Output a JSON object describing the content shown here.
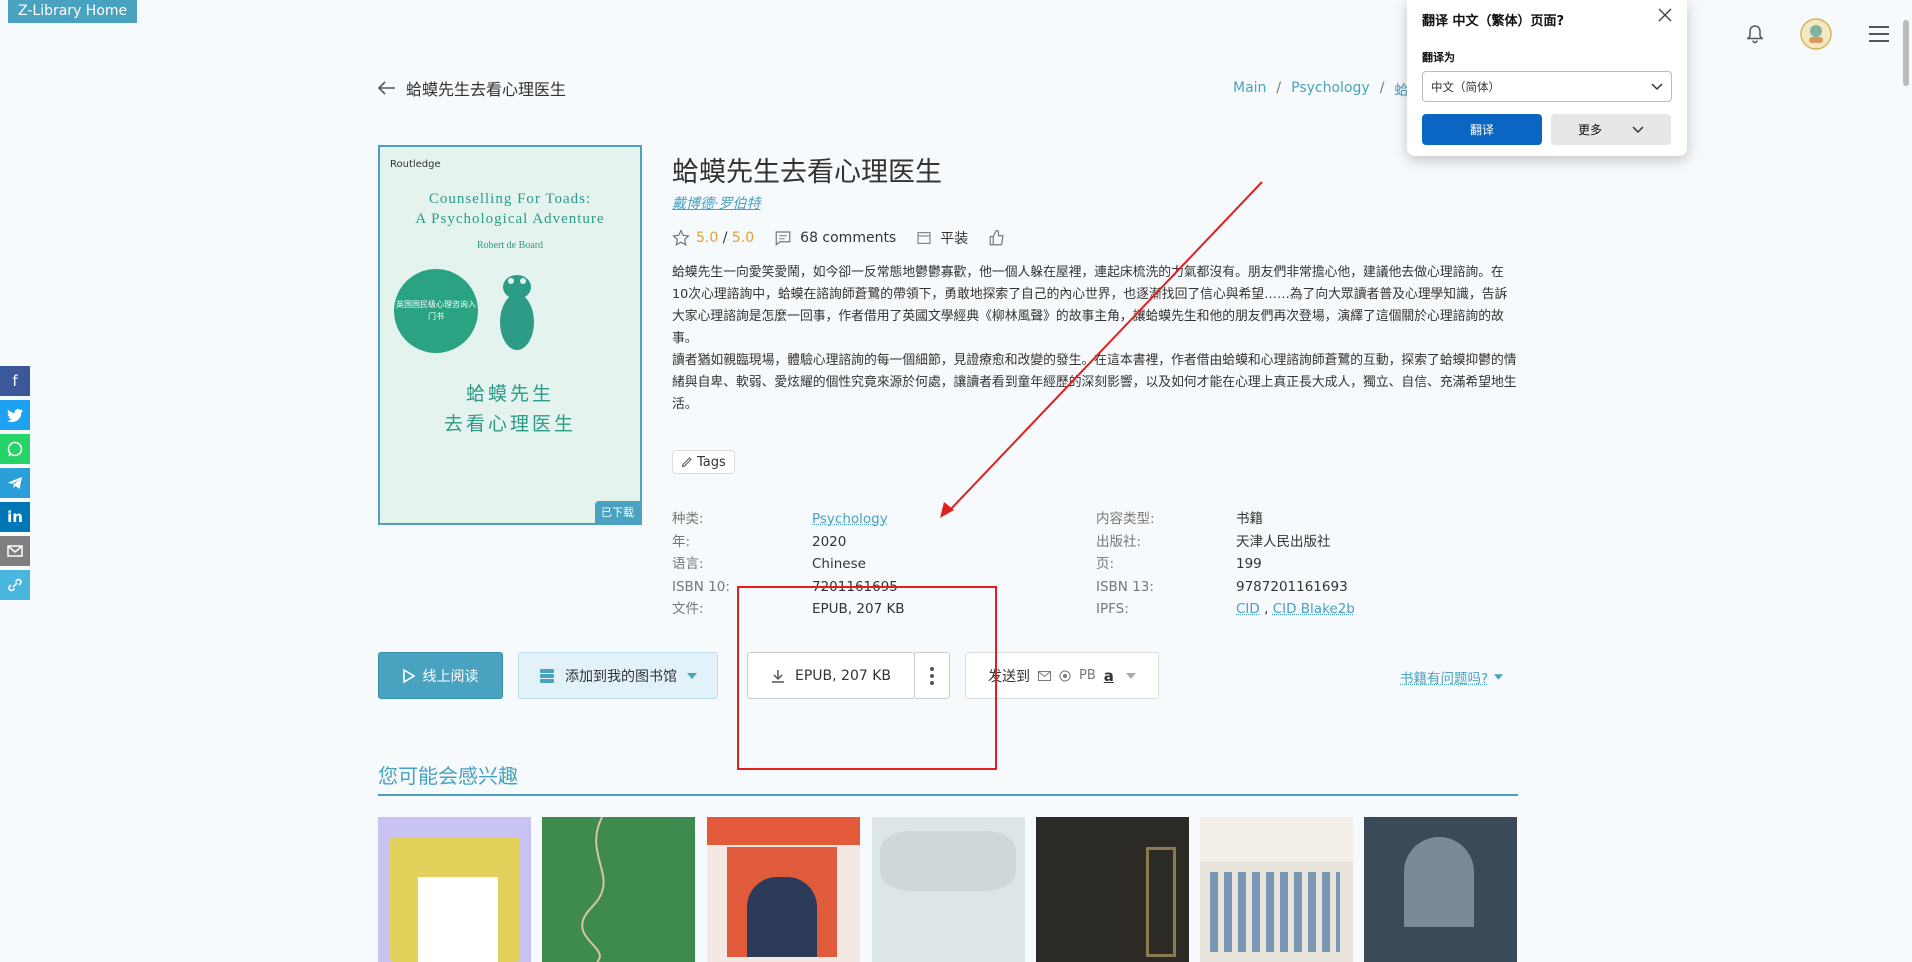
{
  "nav": {
    "home_label": "Z-Library Home"
  },
  "header": {
    "back_title": "蛤蟆先生去看心理医生"
  },
  "breadcrumb": {
    "main": "Main",
    "sep": "/",
    "category": "Psychology",
    "current": "蛤"
  },
  "cover": {
    "publisher_name": "Routledge",
    "english_title_1": "Counselling For Toads:",
    "english_title_2": "A Psychological Adventure",
    "author_en": "Robert de Board",
    "circle_text": "英国国民级心理咨询入门书",
    "chinese_title_1": "蛤蟆先生",
    "chinese_title_2": "去看心理医生",
    "downloaded_badge": "已下载"
  },
  "book": {
    "title": "蛤蟆先生去看心理医生",
    "author": "戴博德·罗伯特",
    "rating": "5.0",
    "rating_sep": " / ",
    "rating_max": "5.0",
    "comments": "68 comments",
    "format_tag": "平装",
    "description": [
      "蛤蟆先生一向愛笑愛鬧，如今卻一反常態地鬱鬱寡歡，他一個人躲在屋裡，連起床梳洗的力氣都沒有。朋友們非常擔心他，建議他去做心理諮詢。在10次心理諮詢中，蛤蟆在諮詢師蒼鷺的帶領下，勇敢地探索了自己的內心世界，也逐漸找回了信心與希望……為了向大眾讀者普及心理學知識，告訴大家心理諮詢是怎麼一回事，作者借用了英國文學經典《柳林風聲》的故事主角，讓蛤蟆先生和他的朋友們再次登場，演繹了這個關於心理諮詢的故事。",
      "讀者猶如親臨現場，體驗心理諮詢的每一個細節，見證療愈和改變的發生。在這本書裡，作者借由蛤蟆和心理諮詢師蒼鷺的互動，探索了蛤蟆抑鬱的情緒與自卑、軟弱、愛炫耀的個性究竟來源於何處，讓讀者看到童年經歷的深刻影響，以及如何才能在心理上真正長大成人，獨立、自信、充滿希望地生活。"
    ],
    "tags_label": "Tags"
  },
  "props_left": [
    {
      "k": "种类:",
      "v": "Psychology"
    },
    {
      "k": "年:",
      "v": "2020"
    },
    {
      "k": "语言:",
      "v": "Chinese"
    },
    {
      "k": "ISBN 10:",
      "v": "7201161695"
    },
    {
      "k": "文件:",
      "v": "EPUB, 207 KB"
    }
  ],
  "props_right": [
    {
      "k": "内容类型:",
      "v": "书籍"
    },
    {
      "k": "出版社:",
      "v": "天津人民出版社"
    },
    {
      "k": "页:",
      "v": "199"
    },
    {
      "k": "ISBN 13:",
      "v": "9787201161693"
    },
    {
      "k": "IPFS:",
      "v1": "CID",
      "v2": "CID Blake2b",
      "comma": " , "
    }
  ],
  "actions": {
    "read_online": "线上阅读",
    "add_library": "添加到我的图书馆",
    "download": "EPUB, 207 KB",
    "send_to": "发送到",
    "send_pb": "PB",
    "send_amazon": "a",
    "problem": "书籍有问题吗?"
  },
  "recommend": {
    "title": "您可能会感兴趣"
  },
  "translate_popup": {
    "title": "翻译 中文（繁体）页面?",
    "label": "翻译为",
    "selected": "中文（简体）",
    "translate_btn": "翻译",
    "more_btn": "更多"
  },
  "colors": {
    "accent": "#49a2c0",
    "annotation": "#e0201e",
    "popup_primary": "#0a66c2"
  }
}
